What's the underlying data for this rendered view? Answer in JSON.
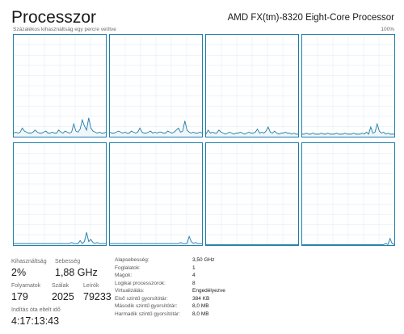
{
  "header": {
    "title": "Processzor",
    "cpu_name": "AMD FX(tm)-8320 Eight-Core Processor",
    "graph_caption": "Százalékos kihasználtság egy percre vetítve",
    "graph_max": "100%"
  },
  "colors": {
    "graph_border": "#1d7ea8",
    "graph_line": "#1d7ea8",
    "graph_fill": "#f1f6fa",
    "grid_line": "#d9eaf3"
  },
  "chart_data": {
    "type": "line",
    "ylim": [
      0,
      100
    ],
    "series": [
      {
        "values": [
          3,
          4,
          3,
          4,
          8,
          5,
          4,
          3,
          3,
          4,
          6,
          4,
          3,
          3,
          4,
          5,
          3,
          3,
          4,
          3,
          3,
          6,
          4,
          3,
          5,
          4,
          3,
          4,
          12,
          5,
          4,
          7,
          16,
          10,
          6,
          18,
          8,
          5,
          4,
          3,
          4,
          3,
          3,
          4
        ]
      },
      {
        "values": [
          4,
          3,
          3,
          4,
          5,
          4,
          3,
          4,
          3,
          3,
          5,
          4,
          3,
          4,
          8,
          4,
          3,
          3,
          4,
          5,
          3,
          4,
          3,
          4,
          4,
          3,
          3,
          5,
          4,
          3,
          4,
          6,
          8,
          4,
          5,
          15,
          6,
          4,
          3,
          4,
          3,
          3,
          4,
          3
        ]
      },
      {
        "values": [
          2,
          6,
          3,
          4,
          3,
          3,
          6,
          4,
          3,
          2,
          3,
          4,
          3,
          2,
          3,
          3,
          4,
          3,
          2,
          3,
          4,
          3,
          3,
          4,
          7,
          3,
          4,
          3,
          5,
          9,
          4,
          3,
          5,
          3,
          2,
          3,
          3,
          4,
          3,
          3,
          2,
          3,
          2,
          2
        ]
      },
      {
        "values": [
          2,
          2,
          3,
          2,
          2,
          3,
          2,
          2,
          2,
          3,
          2,
          2,
          3,
          2,
          2,
          2,
          3,
          2,
          2,
          2,
          3,
          2,
          2,
          2,
          3,
          2,
          2,
          2,
          3,
          2,
          4,
          2,
          9,
          3,
          4,
          12,
          5,
          3,
          4,
          2,
          3,
          2,
          2,
          2
        ]
      },
      {
        "values": [
          1,
          1,
          1,
          1,
          1,
          1,
          1,
          1,
          1,
          1,
          1,
          1,
          1,
          1,
          1,
          1,
          1,
          1,
          1,
          1,
          1,
          1,
          1,
          1,
          1,
          1,
          1,
          2,
          1,
          1,
          1,
          4,
          1,
          3,
          12,
          3,
          5,
          2,
          1,
          2,
          1,
          1,
          1,
          1
        ]
      },
      {
        "values": [
          1,
          1,
          1,
          1,
          1,
          1,
          1,
          1,
          1,
          1,
          1,
          1,
          1,
          1,
          1,
          1,
          1,
          1,
          1,
          1,
          1,
          1,
          1,
          1,
          1,
          1,
          1,
          1,
          1,
          1,
          1,
          1,
          1,
          2,
          1,
          1,
          1,
          8,
          3,
          1,
          2,
          1,
          1,
          1
        ]
      },
      {
        "values": [
          0,
          0,
          0,
          0,
          0,
          0,
          0,
          0,
          0,
          0,
          0,
          0,
          0,
          0,
          0,
          0,
          0,
          0,
          0,
          0,
          0,
          0,
          0,
          0,
          0,
          0,
          0,
          0,
          0,
          0,
          0,
          0,
          0,
          0,
          0,
          0,
          0,
          0,
          0,
          0,
          0,
          0,
          0,
          0
        ]
      },
      {
        "values": [
          0,
          0,
          0,
          0,
          0,
          0,
          0,
          0,
          0,
          0,
          0,
          0,
          0,
          0,
          0,
          0,
          0,
          0,
          0,
          0,
          0,
          0,
          0,
          0,
          0,
          0,
          0,
          0,
          0,
          0,
          0,
          0,
          0,
          0,
          0,
          0,
          0,
          0,
          0,
          1,
          0,
          6,
          1,
          0
        ]
      }
    ]
  },
  "stats": {
    "utilization": {
      "label": "Kihasználtság",
      "value": "2%"
    },
    "speed": {
      "label": "Sebesség",
      "value": "1,88 GHz"
    },
    "processes": {
      "label": "Folyamatok",
      "value": "179"
    },
    "threads": {
      "label": "Szálak",
      "value": "2025"
    },
    "handles": {
      "label": "Leírók",
      "value": "79233"
    },
    "uptime": {
      "label": "Indítás óta eltelt idő",
      "value": "4:17:13:43"
    }
  },
  "info": [
    {
      "key": "Alapsebesség:",
      "value": "3,50 GHz"
    },
    {
      "key": "Foglalatok:",
      "value": "1"
    },
    {
      "key": "Magok:",
      "value": "4"
    },
    {
      "key": "Logikai processzorok:",
      "value": "8"
    },
    {
      "key": "Virtualizálás:",
      "value": "Engedélyezve"
    },
    {
      "key": "Első szintű gyorsítótár:",
      "value": "384 KB"
    },
    {
      "key": "Második szintű gyorsítótár:",
      "value": "8,0 MB"
    },
    {
      "key": "Harmadik szintű gyorsítótár:",
      "value": "8,0 MB"
    }
  ]
}
